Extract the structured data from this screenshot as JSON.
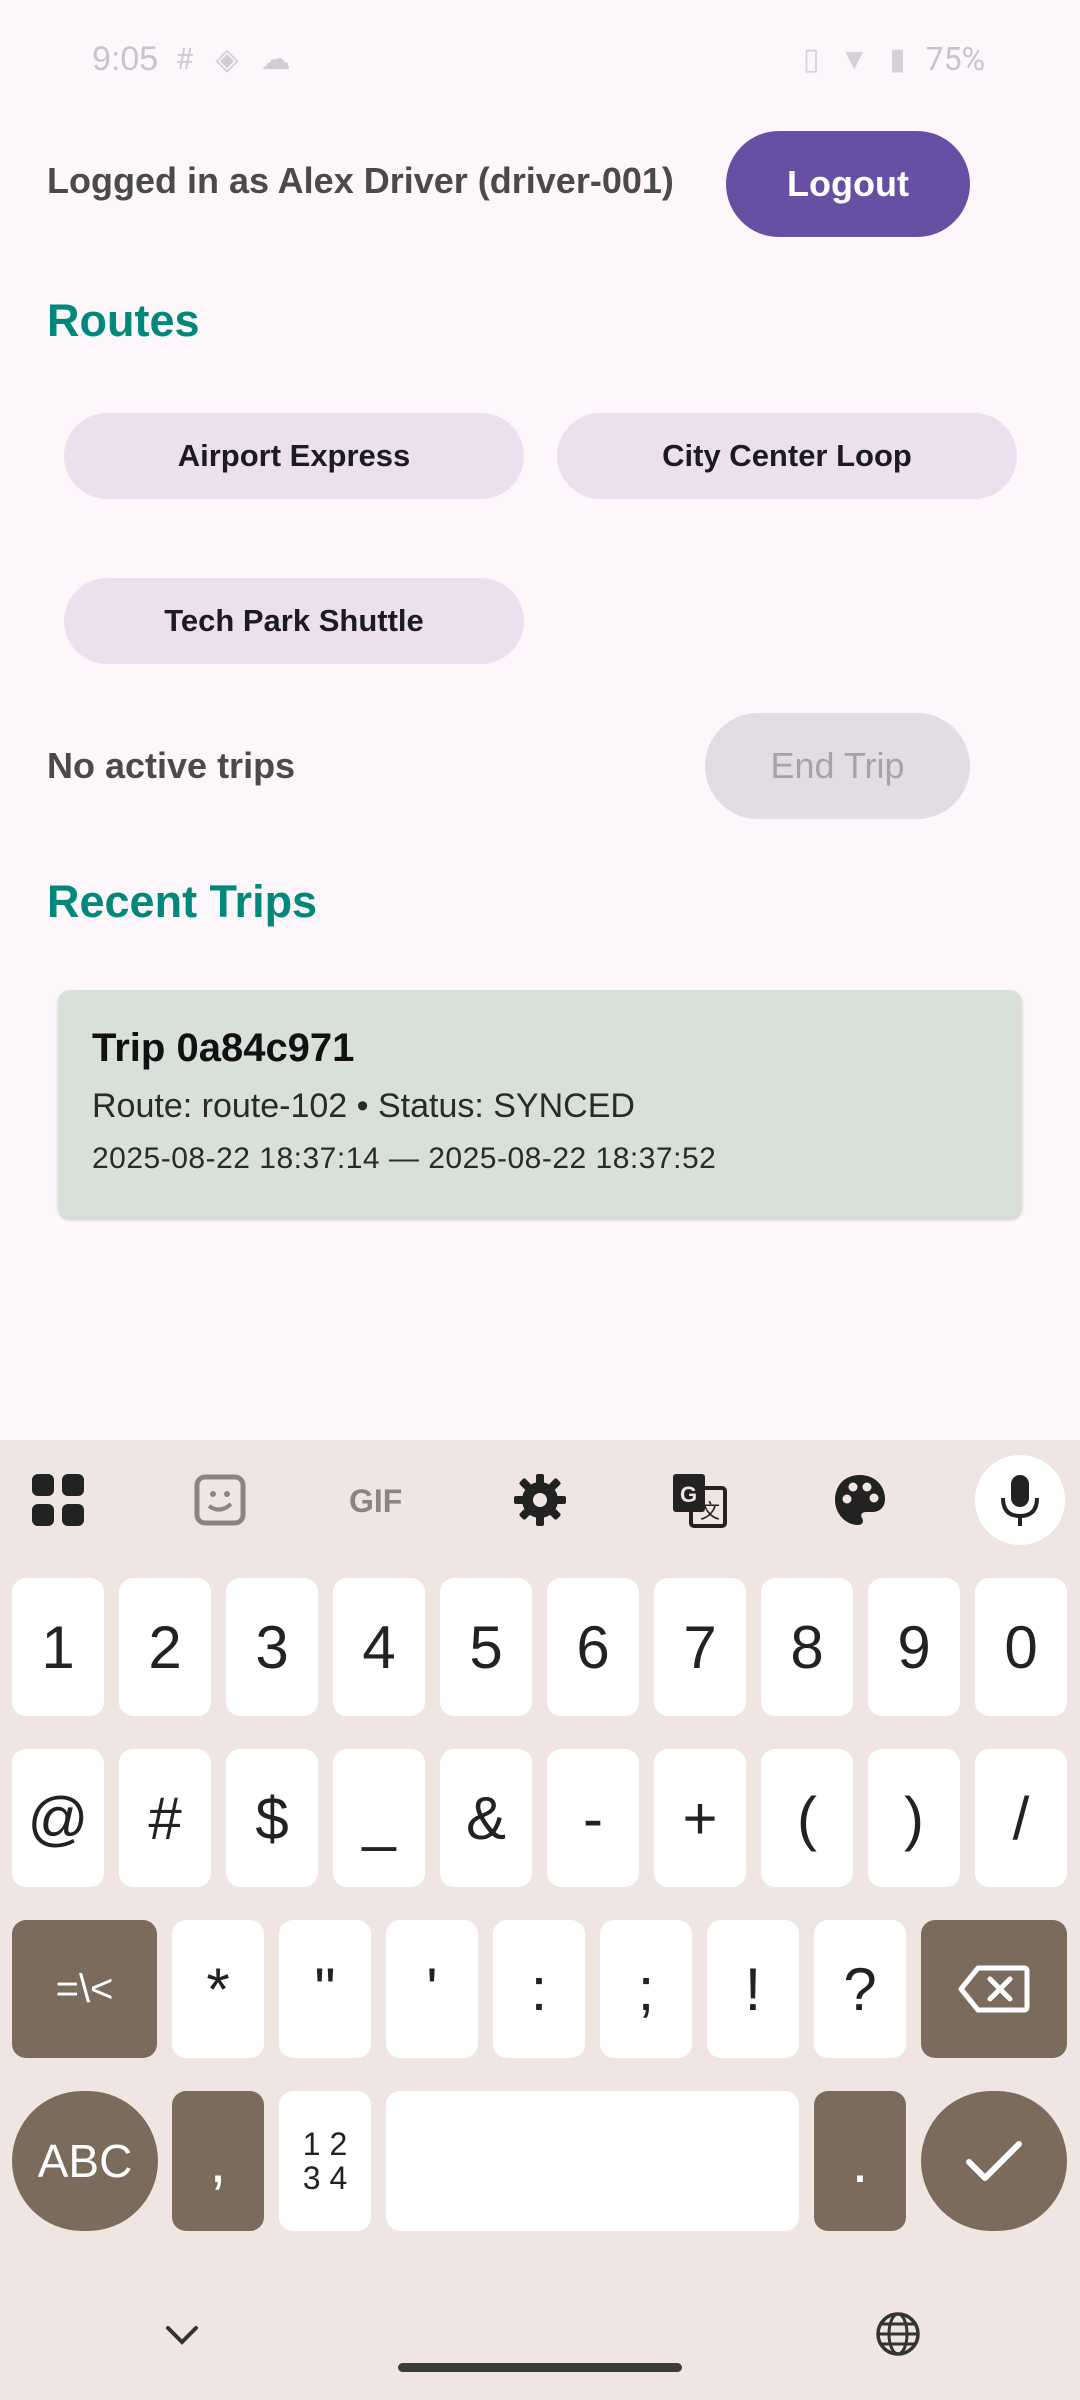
{
  "status_bar": {
    "time": "9:05",
    "battery": "75%"
  },
  "header": {
    "login_text": "Logged in as Alex Driver (driver-001)",
    "logout_label": "Logout"
  },
  "routes": {
    "title": "Routes",
    "items": [
      {
        "label": "Airport Express"
      },
      {
        "label": "City Center Loop"
      },
      {
        "label": "Tech Park Shuttle"
      }
    ]
  },
  "active_trip": {
    "status": "No active trips",
    "end_trip_label": "End Trip"
  },
  "recent_trips": {
    "title": "Recent Trips",
    "items": [
      {
        "title": "Trip 0a84c971",
        "route_status": "Route: route-102 • Status: SYNCED",
        "times": "2025-08-22 18:37:14  —  2025-08-22 18:37:52"
      }
    ]
  },
  "keyboard": {
    "row1": [
      "1",
      "2",
      "3",
      "4",
      "5",
      "6",
      "7",
      "8",
      "9",
      "0"
    ],
    "row2": [
      "@",
      "#",
      "$",
      "_",
      "&",
      "-",
      "+",
      "(",
      ")",
      "/"
    ],
    "row3_mode": "=\\<",
    "row3": [
      "*",
      "\"",
      "'",
      ":",
      ";",
      "!",
      "?"
    ],
    "abc_label": "ABC",
    "comma": ",",
    "numpad_label_top": "1 2",
    "numpad_label_bottom": "3 4",
    "period": "."
  },
  "colors": {
    "accent": "#6750a4",
    "section_title": "#00897b",
    "chip_bg": "#ecdfee",
    "card_bg": "#d8e0da",
    "keyboard_bg": "#efe6e3",
    "key_dark": "#7a6b5d"
  }
}
